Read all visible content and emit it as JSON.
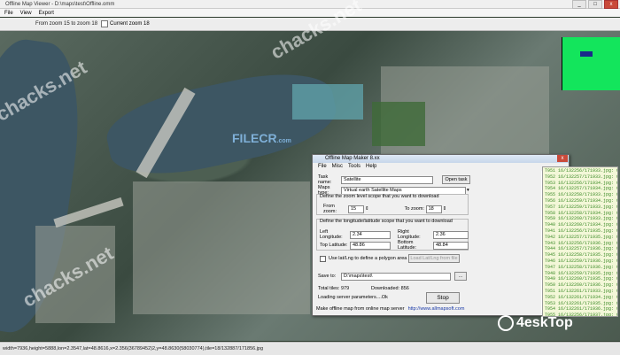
{
  "window": {
    "title": "Offline Map Viewer - D:\\maps\\test\\Offline.omm",
    "controls": [
      "_",
      "□",
      "x"
    ]
  },
  "menubar": {
    "items": [
      "File",
      "View",
      "Export"
    ]
  },
  "toolbar": {
    "zoom_label": "From zoom 15 to zoom 18",
    "current_zoom_label": "Current zoom 18"
  },
  "map": {
    "provider": "Satellite",
    "minimap_color": "#13e55c"
  },
  "statusbar": {
    "text": "width=7936,height=5888,lon=2.3547,lat=48.8616,x=2.356(36789452)2,y=48.8630(58030774),tile=18/132887/171856.jpg"
  },
  "dialog": {
    "title": "Offline Map Maker 8.xx",
    "menu": [
      "File",
      "Misc",
      "Tools",
      "Help"
    ],
    "task_name_label": "Task name:",
    "task_name_value": "Satellite",
    "open_task_label": "Open task",
    "maps_type_label": "Maps type:",
    "maps_type_value": "Virtual earth Satellite Maps",
    "zoom_scope_label": "Define the zoom level scope that you want to download",
    "from_zoom_label": "From zoom:",
    "from_zoom_value": "15",
    "to_zoom_label": "To zoom:",
    "to_zoom_value": "18",
    "latlng_scope_label": "Define the longitude/latitude scope that you want to download",
    "left_lng_label": "Left Longitude:",
    "left_lng_value": "2.34",
    "right_lng_label": "Right Longitude:",
    "right_lng_value": "2.36",
    "top_lat_label": "Top Latitude:",
    "top_lat_value": "48.86",
    "bottom_lat_label": "Bottom Latitude:",
    "bottom_lat_value": "48.84",
    "polygon_label": "Use lat/Lng to define a polygon area",
    "polygon_button": "Load Lat/Lng from file",
    "save_to_label": "Save to:",
    "save_to_value": "D:\\maps\\test\\",
    "browse_label": "...",
    "total_tiles_label": "Total tiles: 979",
    "downloaded_label": "Downloaded: 856",
    "loading_label": "Loading server parameters....Ok",
    "stop_label": "Stop",
    "footer_text": "Make offline map from online map server",
    "footer_url": "http://www.allmapsoft.com"
  },
  "log": {
    "lines": [
      "T951 16/132256/171933.jpg: OK",
      "T952 16/132257/171933.jpg: OK",
      "T953 16/132256/171934.jpg: OK",
      "T954 16/132257/171934.jpg: OK",
      "T955 16/132258/171933.jpg: OK",
      "T956 16/132259/171934.jpg: OK",
      "T957 16/132259/171933.jpg: OK",
      "T958 16/132258/171934.jpg: OK",
      "T959 16/132260/171933.jpg: OK",
      "T940 16/132260/171934.jpg: OK",
      "T941 16/132256/171935.jpg: OK",
      "T942 16/132257/171935.jpg: OK",
      "T943 16/132256/171936.jpg: OK",
      "T944 16/132257/171936.jpg: OK",
      "T945 16/132258/171935.jpg: OK",
      "T946 16/132259/171936.jpg: OK",
      "T947 16/132258/171936.jpg: OK",
      "T948 16/132259/171935.jpg: OK",
      "T949 16/132260/171935.jpg: OK",
      "T950 16/132260/171936.jpg: OK",
      "T951 16/132261/171933.jpg: OK",
      "T952 16/132261/171934.jpg: OK",
      "T953 16/132261/171935.jpg: OK",
      "T954 16/132261/171936.jpg: OK",
      "T955 16/132256/171937.jpg: OK"
    ]
  },
  "watermarks": {
    "chacks": "chacks.net",
    "filecr": "FILECR",
    "filecr_sub": ".com",
    "logo": "4eskTop"
  }
}
